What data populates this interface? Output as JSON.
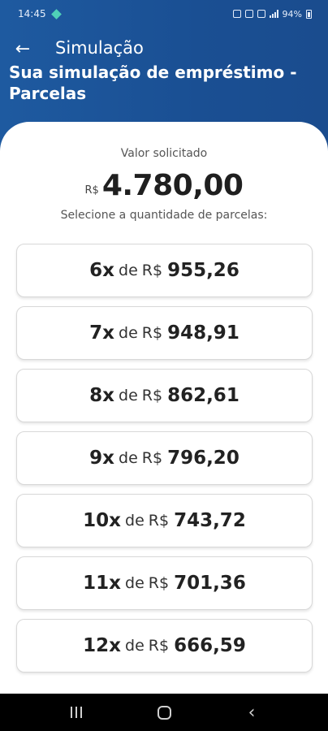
{
  "status_bar": {
    "time": "14:45",
    "battery_text": "94%"
  },
  "header": {
    "back_icon": "arrow-left-icon",
    "appbar_title": "Simulação",
    "page_title": "Sua simulação de empréstimo - Parcelas"
  },
  "summary": {
    "requested_label": "Valor solicitado",
    "currency": "R$",
    "amount": "4.780,00",
    "instruction": "Selecione a quantidade de parcelas:"
  },
  "installments": [
    {
      "count": "6x",
      "de": "de",
      "currency": "R$",
      "value": "955,26"
    },
    {
      "count": "7x",
      "de": "de",
      "currency": "R$",
      "value": "948,91"
    },
    {
      "count": "8x",
      "de": "de",
      "currency": "R$",
      "value": "862,61"
    },
    {
      "count": "9x",
      "de": "de",
      "currency": "R$",
      "value": "796,20"
    },
    {
      "count": "10x",
      "de": "de",
      "currency": "R$",
      "value": "743,72"
    },
    {
      "count": "11x",
      "de": "de",
      "currency": "R$",
      "value": "701,36"
    },
    {
      "count": "12x",
      "de": "de",
      "currency": "R$",
      "value": "666,59"
    }
  ],
  "colors": {
    "header_blue": "#1e5aa0",
    "card_border": "#d8d8d8"
  },
  "navbar": {
    "recent_icon": "recent-apps-icon",
    "home_icon": "home-icon",
    "back_icon": "back-chevron-icon"
  }
}
